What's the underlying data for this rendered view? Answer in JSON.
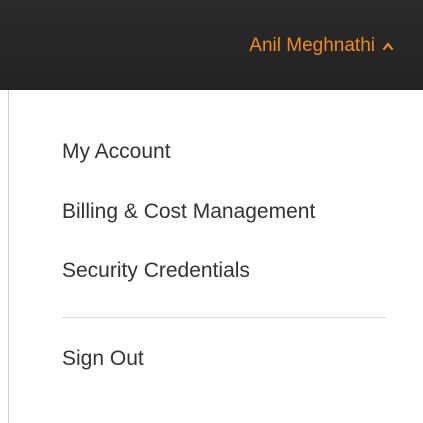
{
  "header": {
    "user_name": "Anil Meghnathi",
    "toggle_icon": "caret-up-icon",
    "user_name_color": "#f08a1c",
    "background_color": "#252525"
  },
  "menu": {
    "items": [
      {
        "label": "My Account"
      },
      {
        "label": "Billing & Cost Management"
      },
      {
        "label": "Security Credentials"
      }
    ],
    "sign_out_label": "Sign Out"
  }
}
